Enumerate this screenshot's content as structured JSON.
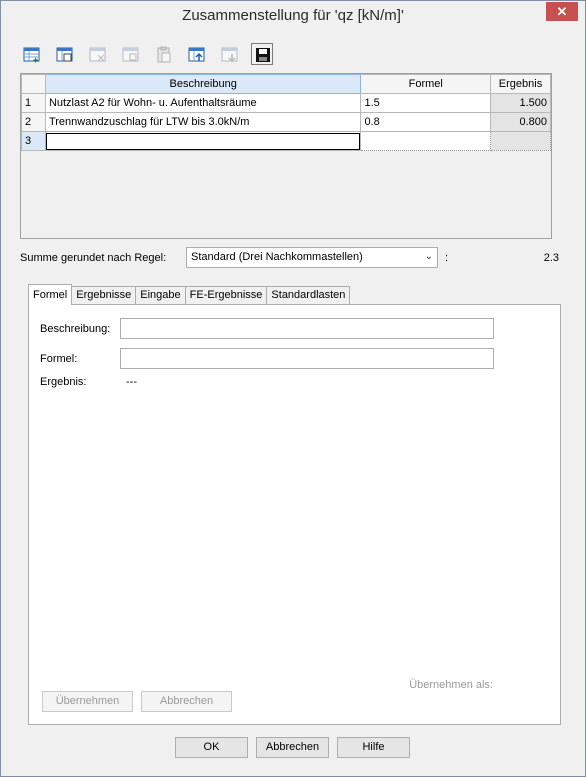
{
  "window": {
    "title": "Zusammenstellung für 'qz [kN/m]'",
    "close_glyph": "✕"
  },
  "toolbar": {
    "buttons": [
      {
        "icon": "insert-row-icon",
        "enabled": true
      },
      {
        "icon": "copy-row-icon",
        "enabled": true
      },
      {
        "icon": "delete-row-icon",
        "enabled": false
      },
      {
        "icon": "cut-icon",
        "enabled": false
      },
      {
        "icon": "paste-icon",
        "enabled": false
      },
      {
        "icon": "move-up-icon",
        "enabled": true
      },
      {
        "icon": "move-down-icon",
        "enabled": false
      },
      {
        "icon": "save-icon",
        "enabled": true
      }
    ]
  },
  "grid": {
    "columns": [
      "Beschreibung",
      "Formel",
      "Ergebnis"
    ],
    "rows": [
      {
        "num": "1",
        "desc": "Nutzlast A2 für Wohn- u. Aufenthaltsräume",
        "formula": "1.5",
        "result": "1.500"
      },
      {
        "num": "2",
        "desc": "Trennwandzuschlag für LTW bis 3.0kN/m",
        "formula": "0.8",
        "result": "0.800"
      },
      {
        "num": "3",
        "desc": "",
        "formula": "",
        "result": ""
      }
    ]
  },
  "sum": {
    "label": "Summe gerundet nach Regel:",
    "rule_selected": "Standard (Drei Nachkommastellen)",
    "colon": ":",
    "value": "2.3"
  },
  "tabs": [
    "Formel",
    "Ergebnisse",
    "Eingabe",
    "FE-Ergebnisse",
    "Standardlasten"
  ],
  "form": {
    "desc_label": "Beschreibung:",
    "desc_value": "",
    "formula_label": "Formel:",
    "formula_value": "",
    "result_label": "Ergebnis:",
    "result_value": "---",
    "accept_as_label": "Übernehmen als:",
    "accept_button": "Übernehmen",
    "cancel_button": "Abbrechen"
  },
  "dialog_buttons": {
    "ok": "OK",
    "cancel": "Abbrechen",
    "help": "Hilfe"
  },
  "colors": {
    "selected_header": "#dbe8f7",
    "result_cell": "#e4e4e4",
    "close_button": "#c75050"
  }
}
